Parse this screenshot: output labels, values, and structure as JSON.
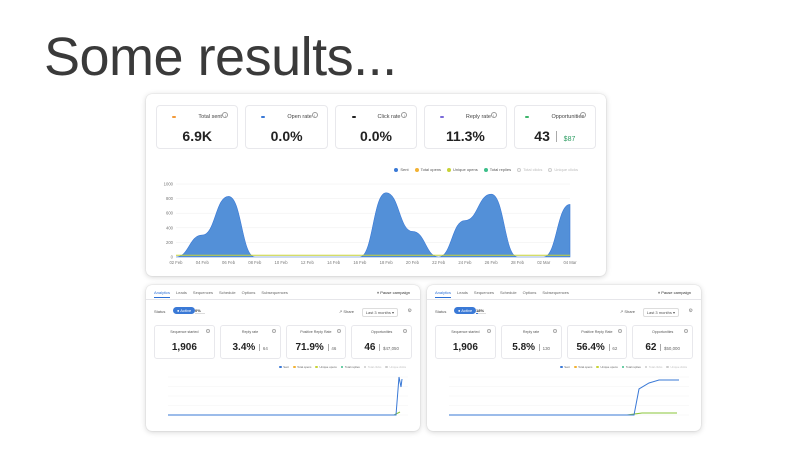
{
  "slide": {
    "title": "Some results..."
  },
  "main": {
    "stats": [
      {
        "label": "Total sent",
        "value": "6.9K",
        "color": "#f29a3a",
        "sub": ""
      },
      {
        "label": "Open rate",
        "value": "0.0%",
        "color": "#3a79d6",
        "sub": ""
      },
      {
        "label": "Click rate",
        "value": "0.0%",
        "color": "#222222",
        "sub": ""
      },
      {
        "label": "Reply rate",
        "value": "11.3%",
        "color": "#7a6ad8",
        "sub": ""
      },
      {
        "label": "Opportunities",
        "value": "43",
        "color": "#3db56b",
        "sub": "$87"
      }
    ],
    "legend": [
      {
        "label": "Sent",
        "color": "#3a79d6",
        "muted": false
      },
      {
        "label": "Total opens",
        "color": "#f2b233",
        "muted": false
      },
      {
        "label": "Unique opens",
        "color": "#c7d236",
        "muted": false
      },
      {
        "label": "Total replies",
        "color": "#3dbf8a",
        "muted": false
      },
      {
        "label": "Total clicks",
        "color": "#dddddd",
        "muted": true
      },
      {
        "label": "Unique clicks",
        "color": "#dddddd",
        "muted": true
      }
    ]
  },
  "left_card": {
    "tabs": [
      "Analytics",
      "Leads",
      "Sequences",
      "Schedule",
      "Options",
      "Subsequences"
    ],
    "pause": "Pause campaign",
    "status_label": "Status",
    "status_badge": "Active",
    "status_pct": "0%",
    "status_progress": 0.0,
    "share": "Share",
    "range": "Last 3 months",
    "stats": [
      {
        "label": "Sequence started",
        "value": "1,906",
        "sub": ""
      },
      {
        "label": "Reply rate",
        "value": "3.4%",
        "sub": "64"
      },
      {
        "label": "Positive Reply Rate",
        "value": "71.9%",
        "sub": "46"
      },
      {
        "label": "Opportunities",
        "value": "46",
        "sub": "$47,050"
      }
    ],
    "legend": [
      "Sent",
      "Total opens",
      "Unique opens",
      "Total replies",
      "Total clicks",
      "Unique clicks"
    ]
  },
  "right_card": {
    "tabs": [
      "Analytics",
      "Leads",
      "Sequences",
      "Schedule",
      "Options",
      "Subsequences"
    ],
    "pause": "Pause campaign",
    "status_label": "Status",
    "status_badge": "Active",
    "status_pct": "18%",
    "status_progress": 0.18,
    "share": "Share",
    "range": "Last 3 months",
    "stats": [
      {
        "label": "Sequence started",
        "value": "1,906",
        "sub": ""
      },
      {
        "label": "Reply rate",
        "value": "5.8%",
        "sub": "130"
      },
      {
        "label": "Positive Reply Rate",
        "value": "56.4%",
        "sub": "62"
      },
      {
        "label": "Opportunities",
        "value": "62",
        "sub": "$50,000"
      }
    ],
    "legend": [
      "Sent",
      "Total opens",
      "Unique opens",
      "Total replies",
      "Total clicks",
      "Unique clicks"
    ]
  },
  "chart_data": [
    {
      "type": "area",
      "x": [
        "02 Feb",
        "04 Feb",
        "06 Feb",
        "08 Feb",
        "10 Feb",
        "12 Feb",
        "14 Feb",
        "16 Feb",
        "18 Feb",
        "20 Feb",
        "22 Feb",
        "24 Feb",
        "26 Feb",
        "28 Feb",
        "02 Mar",
        "04 Mar"
      ],
      "ylim": [
        0,
        1000
      ],
      "yticks": [
        1000,
        800,
        600,
        400,
        200,
        0
      ],
      "series": [
        {
          "name": "Sent",
          "values": [
            0,
            300,
            830,
            0,
            0,
            0,
            0,
            0,
            880,
            350,
            0,
            500,
            860,
            0,
            0,
            720
          ]
        },
        {
          "name": "Total replies",
          "values": [
            10,
            10,
            10,
            10,
            10,
            10,
            10,
            10,
            10,
            10,
            10,
            10,
            10,
            10,
            10,
            10
          ]
        }
      ]
    }
  ]
}
